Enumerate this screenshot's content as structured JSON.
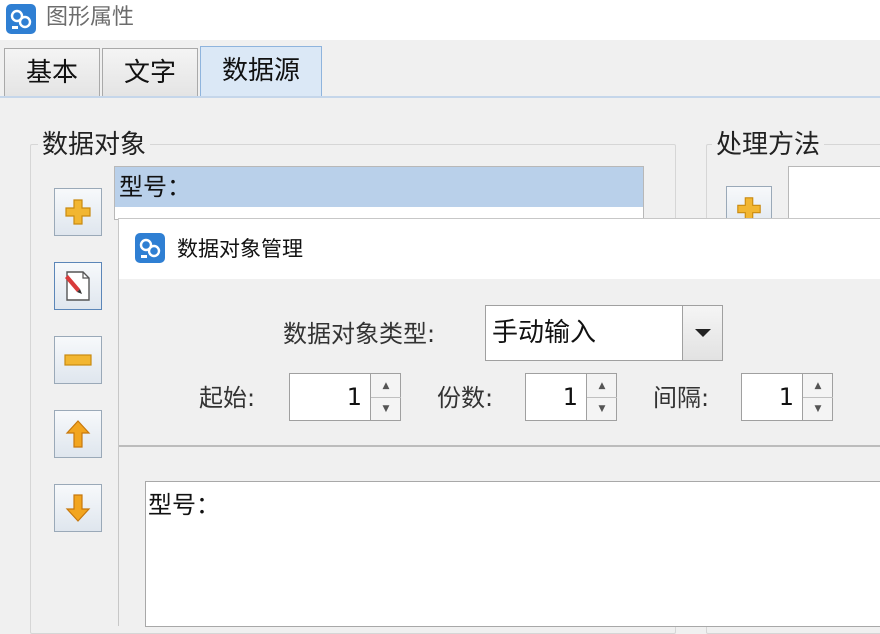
{
  "window": {
    "title": "图形属性",
    "icon": "app-logo-icon"
  },
  "tabs": [
    {
      "label": "基本",
      "active": false
    },
    {
      "label": "文字",
      "active": false
    },
    {
      "label": "数据源",
      "active": true
    }
  ],
  "data_object_group": {
    "title": "数据对象",
    "selected_item": "型号：",
    "buttons": [
      "add-icon",
      "edit-icon",
      "remove-icon",
      "move-up-icon",
      "move-down-icon"
    ]
  },
  "processing_group": {
    "title": "处理方法",
    "buttons": [
      "add-icon"
    ]
  },
  "dialog": {
    "title": "数据对象管理",
    "type_label": "数据对象类型:",
    "type_value": "手动输入",
    "start_label": "起始:",
    "start_value": "1",
    "copies_label": "份数:",
    "copies_value": "1",
    "interval_label": "间隔:",
    "interval_value": "1",
    "content": "型号："
  },
  "colors": {
    "accent": "#b9d0ea",
    "add_icon": "#f2b631",
    "arrow_icon": "#f2a51f"
  }
}
